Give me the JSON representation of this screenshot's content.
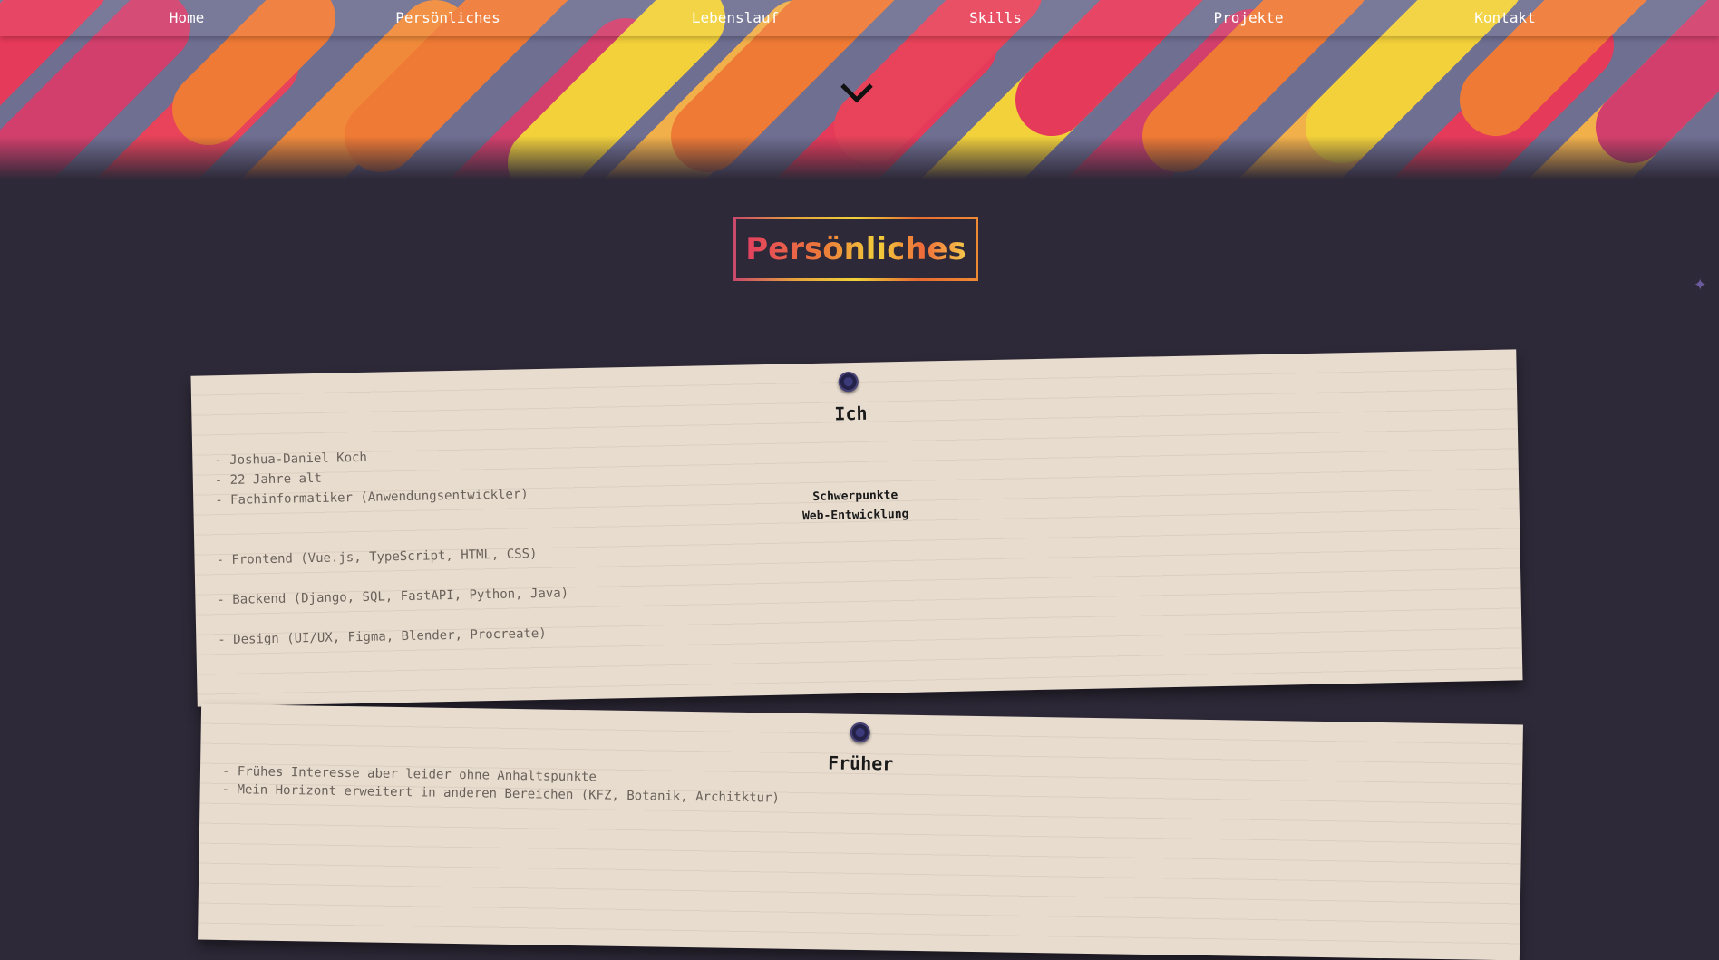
{
  "nav": {
    "items": [
      {
        "label": "Home"
      },
      {
        "label": "Persönliches"
      },
      {
        "label": "Lebenslauf"
      },
      {
        "label": "Skills"
      },
      {
        "label": "Projekte"
      },
      {
        "label": "Kontakt"
      }
    ]
  },
  "hero": {
    "scroll_icon": "chevron-down-icon",
    "colors": [
      "#e63a5a",
      "#ef7a35",
      "#f3d13a",
      "#d23f6c",
      "#f2b04a",
      "#7a7799"
    ]
  },
  "section": {
    "title": "Persönliches",
    "sparkle_icon": "sparkle-icon"
  },
  "cards": {
    "ich": {
      "title": "Ich",
      "lines": [
        "- Joshua-Daniel Koch",
        "- 22 Jahre alt",
        "- Fachinformatiker (Anwendungsentwickler)"
      ],
      "focus_heading": "Schwerpunkte",
      "focus_subheading": "Web-Entwicklung",
      "skills": [
        "- Frontend (Vue.js, TypeScript, HTML, CSS)",
        "- Backend (Django, SQL, FastAPI, Python, Java)",
        "- Design (UI/UX, Figma, Blender, Procreate)"
      ]
    },
    "frueher": {
      "title": "Früher",
      "lines": [
        "- Frühes Interesse aber leider ohne Anhaltspunkte",
        "- Mein Horizont erweitert in anderen Bereichen (KFZ, Botanik, Architktur)"
      ]
    }
  }
}
